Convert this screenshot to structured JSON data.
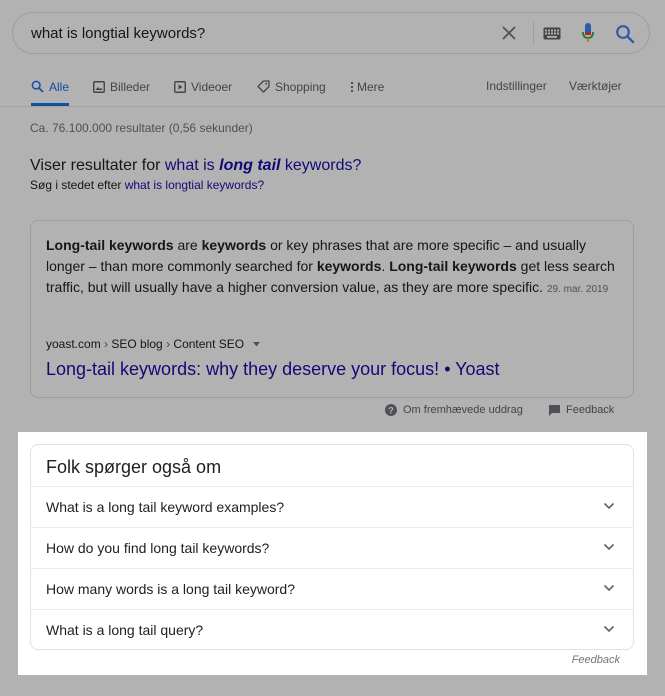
{
  "search": {
    "query": "what is longtial keywords?"
  },
  "tabs": [
    {
      "label": "Alle",
      "icon": "search-icon",
      "active": true
    },
    {
      "label": "Billeder",
      "icon": "image-icon"
    },
    {
      "label": "Videoer",
      "icon": "video-icon"
    },
    {
      "label": "Shopping",
      "icon": "tag-icon"
    },
    {
      "label": "Mere",
      "icon": "more-vert-icon"
    }
  ],
  "tools": {
    "settings": "Indstillinger",
    "tools": "Værktøjer"
  },
  "result_stats": "Ca. 76.100.000 resultater (0,56 sekunder)",
  "correction": {
    "showing_prefix": "Viser resultater for ",
    "showing_link_a": "what is ",
    "showing_link_b": "long tail",
    "showing_link_c": " keywords?",
    "instead_prefix": "Søg i stedet efter ",
    "instead_link": "what is longtial keywords?"
  },
  "snippet": {
    "parts": [
      {
        "b": "Long-tail keywords"
      },
      {
        "t": " are "
      },
      {
        "b": "keywords"
      },
      {
        "t": " or key phrases that are more specific – and usually longer – than more commonly searched for "
      },
      {
        "b": "keywords"
      },
      {
        "t": ". "
      },
      {
        "b": "Long-tail keywords"
      },
      {
        "t": " get less search traffic, but will usually have a higher conversion value, as they are more specific."
      }
    ],
    "date": "29. mar. 2019",
    "breadcrumb": [
      "yoast.com",
      "SEO blog",
      "Content SEO"
    ],
    "title": "Long-tail keywords: why they deserve your focus! • Yoast",
    "about_label": "Om fremhævede uddrag",
    "feedback_label": "Feedback"
  },
  "paa": {
    "title": "Folk spørger også om",
    "questions": [
      "What is a long tail keyword examples?",
      "How do you find long tail keywords?",
      "How many words is a long tail keyword?",
      "What is a long tail query?"
    ],
    "feedback_label": "Feedback"
  },
  "colors": {
    "link": "#1a0dab",
    "accent": "#1a73e8",
    "mic_red": "#ea4335"
  }
}
